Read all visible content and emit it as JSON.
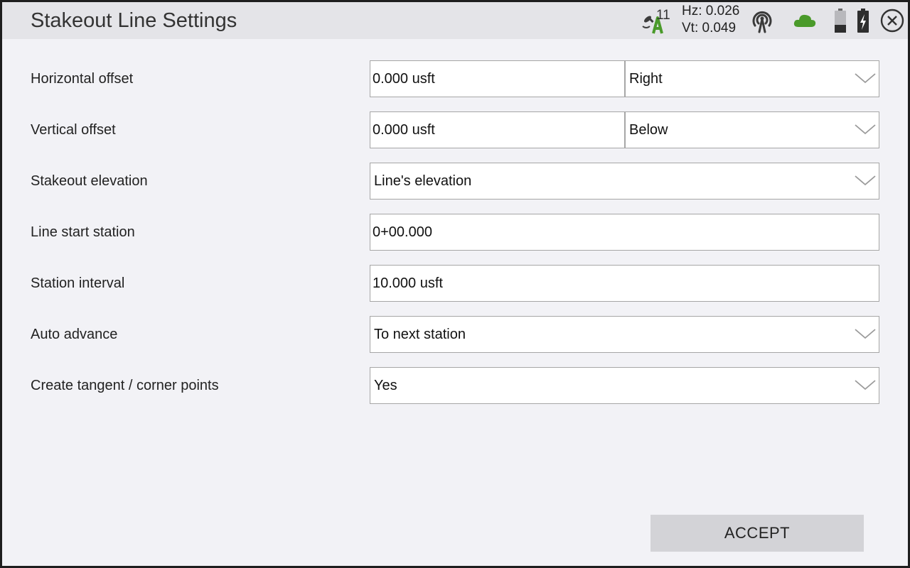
{
  "window": {
    "title": "Stakeout Line Settings"
  },
  "status": {
    "satellite_icon": "satellite-dish-icon",
    "satellite_count": "11",
    "hz": "Hz: 0.026",
    "vt": "Vt: 0.049",
    "radio_icon": "radio-signal-icon",
    "cloud_icon": "cloud-icon",
    "cloud_color": "#4a9a2a",
    "battery_icons": [
      "battery-icon",
      "battery-charging-icon"
    ],
    "close_icon": "close-icon"
  },
  "form": {
    "horizontal_offset": {
      "label": "Horizontal offset",
      "value": "0.000 usft",
      "direction": "Right"
    },
    "vertical_offset": {
      "label": "Vertical offset",
      "value": "0.000 usft",
      "direction": "Below"
    },
    "stakeout_elevation": {
      "label": "Stakeout elevation",
      "value": "Line's elevation"
    },
    "line_start_station": {
      "label": "Line start station",
      "value": "0+00.000"
    },
    "station_interval": {
      "label": "Station interval",
      "value": "10.000 usft"
    },
    "auto_advance": {
      "label": "Auto advance",
      "value": "To next station"
    },
    "create_tangent_corner_points": {
      "label": "Create tangent / corner points",
      "value": "Yes"
    }
  },
  "actions": {
    "accept_label": "ACCEPT"
  },
  "colors": {
    "window_bg": "#f2f2f6",
    "titlebar_bg": "#e4e4e8",
    "field_border": "#a6a6a6",
    "button_bg": "#d3d3d7"
  }
}
